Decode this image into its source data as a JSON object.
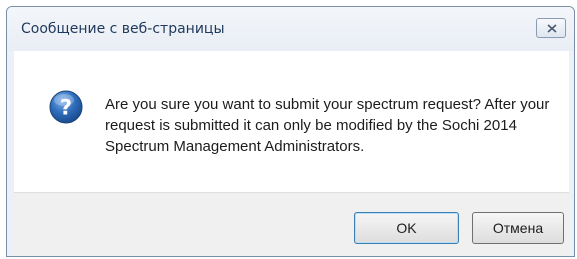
{
  "dialog": {
    "title": "Сообщение с веб-страницы",
    "message": "Are you sure you want to submit your spectrum request? After your request is submitted it can only be modified by the Sochi 2014 Spectrum Management Administrators.",
    "icon": "question-icon",
    "buttons": {
      "ok_label": "OK",
      "cancel_label": "Отмена"
    }
  },
  "colors": {
    "title_text": "#1e395b",
    "icon_blue": "#2f6dbb",
    "content_bg": "#ffffff",
    "footer_bg": "#f0f0f0"
  }
}
